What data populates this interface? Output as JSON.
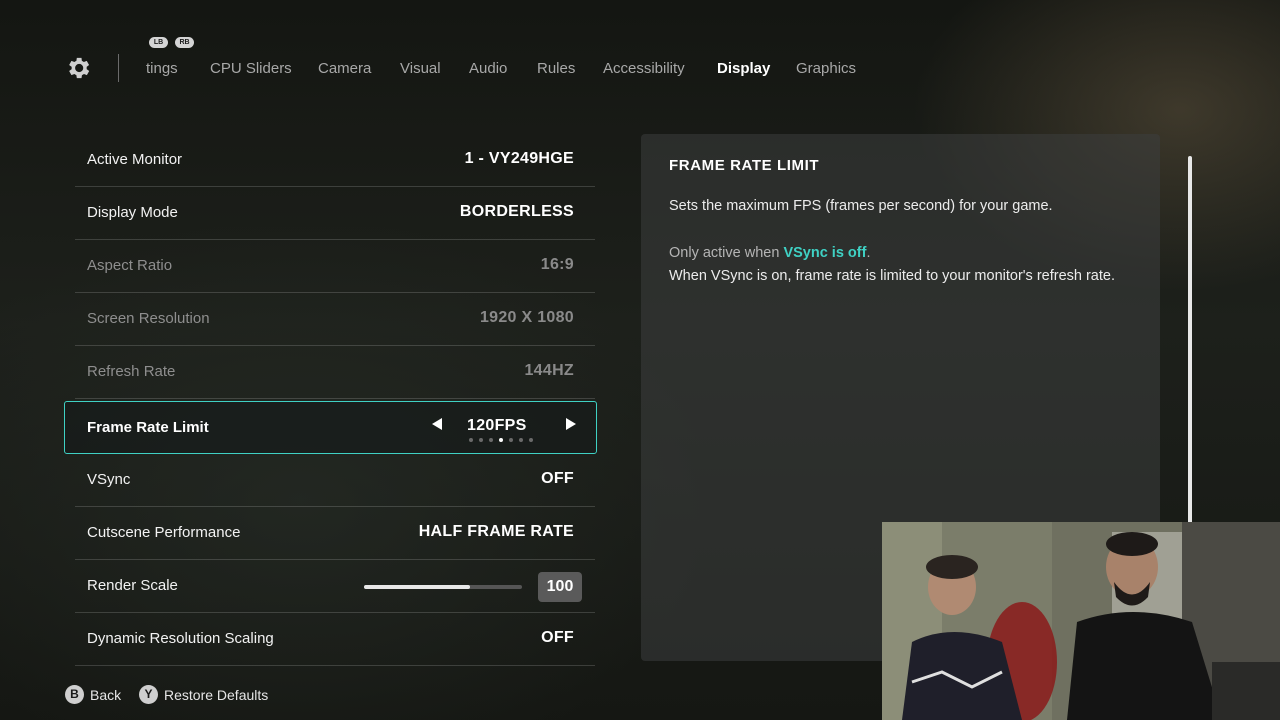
{
  "nav": {
    "bumper_left": "LB",
    "bumper_right": "RB",
    "tabs": [
      {
        "label": "tings",
        "active": false
      },
      {
        "label": "CPU Sliders",
        "active": false
      },
      {
        "label": "Camera",
        "active": false
      },
      {
        "label": "Visual",
        "active": false
      },
      {
        "label": "Audio",
        "active": false
      },
      {
        "label": "Rules",
        "active": false
      },
      {
        "label": "Accessibility",
        "active": false
      },
      {
        "label": "Display",
        "active": true
      },
      {
        "label": "Graphics",
        "active": false
      }
    ]
  },
  "settings": [
    {
      "label": "Active Monitor",
      "value": "1 - VY249HGE",
      "disabled": false
    },
    {
      "label": "Display Mode",
      "value": "BORDERLESS",
      "disabled": false
    },
    {
      "label": "Aspect Ratio",
      "value": "16:9",
      "disabled": true
    },
    {
      "label": "Screen Resolution",
      "value": "1920 X 1080",
      "disabled": true
    },
    {
      "label": "Refresh Rate",
      "value": "144HZ",
      "disabled": true
    },
    {
      "label": "Frame Rate Limit",
      "value": "120FPS",
      "selected": true,
      "option_count": 7,
      "option_index": 3
    },
    {
      "label": "VSync",
      "value": "OFF",
      "disabled": false
    },
    {
      "label": "Cutscene Performance",
      "value": "HALF FRAME RATE",
      "disabled": false
    },
    {
      "label": "Render Scale",
      "value": "100",
      "slider_fraction": 0.67
    },
    {
      "label": "Dynamic Resolution Scaling",
      "value": "OFF",
      "disabled": false
    }
  ],
  "info": {
    "title": "FRAME RATE LIMIT",
    "description": "Sets the maximum FPS (frames per second) for your game.",
    "note_prefix": "Only active when",
    "note_highlight": "VSync is off",
    "note_suffix": ".",
    "note_line2": "When VSync is on, frame rate is limited to your monitor's refresh rate."
  },
  "hints": [
    {
      "button": "B",
      "label": "Back"
    },
    {
      "button": "Y",
      "label": "Restore Defaults"
    }
  ],
  "colors": {
    "accent": "#3fd1c4",
    "text": "#ffffff",
    "disabled_text": "#8a8a8a"
  },
  "icons": {
    "settings": "gear-icon",
    "prev": "arrow-left-icon",
    "next": "arrow-right-icon"
  }
}
